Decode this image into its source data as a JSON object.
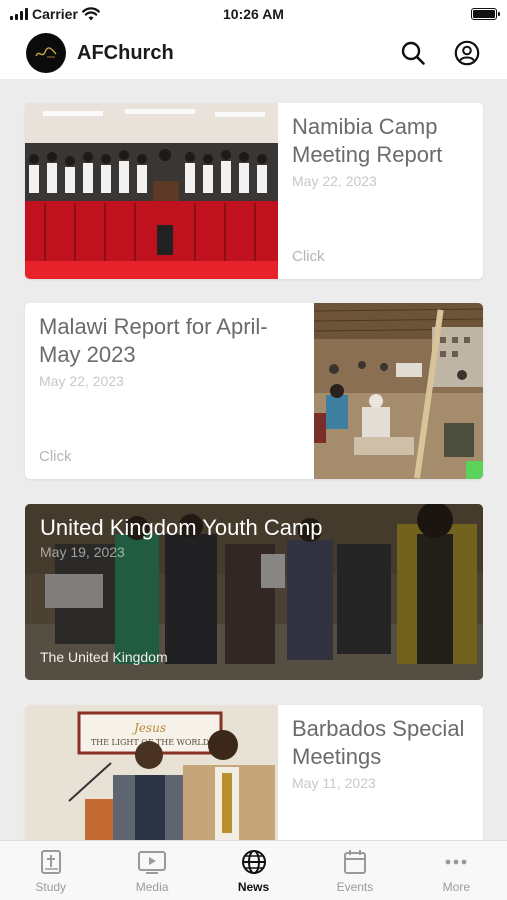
{
  "status_bar": {
    "carrier": "Carrier",
    "time": "10:26 AM"
  },
  "header": {
    "title": "AFChurch",
    "logo_icon": "church-logo-icon",
    "actions": [
      "search-icon",
      "account-icon"
    ]
  },
  "articles": [
    {
      "title": "Namibia Camp Meeting Report",
      "date": "May 22, 2023",
      "link": "Click",
      "layout": "image-left"
    },
    {
      "title": "Malawi Report for April-May 2023",
      "date": "May 22, 2023",
      "link": "Click",
      "layout": "image-right"
    },
    {
      "title": "United Kingdom Youth Camp",
      "date": "May 19, 2023",
      "subtitle": "The United Kingdom",
      "layout": "full-bleed"
    },
    {
      "title": "Barbados Special Meetings",
      "date": "May 11, 2023",
      "layout": "image-left",
      "photo_text": "Jesus THE LIGHT OF THE WORLD"
    }
  ],
  "tabs": [
    {
      "label": "Study",
      "icon": "bible-icon",
      "active": false
    },
    {
      "label": "Media",
      "icon": "play-icon",
      "active": false
    },
    {
      "label": "News",
      "icon": "globe-icon",
      "active": true
    },
    {
      "label": "Events",
      "icon": "calendar-icon",
      "active": false
    },
    {
      "label": "More",
      "icon": "more-icon",
      "active": false
    }
  ],
  "colors": {
    "accent": "#111111",
    "inactive": "#9a9a9a",
    "background": "#ececec"
  }
}
